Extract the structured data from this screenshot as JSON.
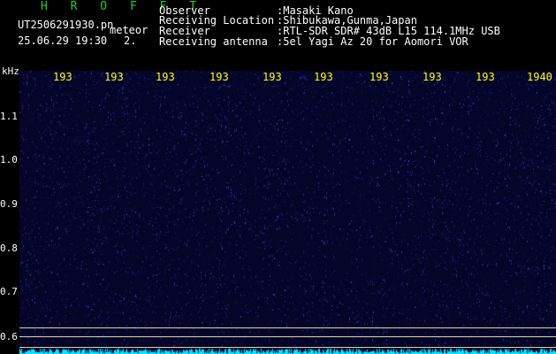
{
  "header": {
    "title": "H R O F F T",
    "filename": "UT2506291930.pn",
    "meteor_label": "meteor",
    "datetime": "25.06.29 19:30",
    "count": "2."
  },
  "station": {
    "rows": [
      {
        "key": "Observer",
        "value": ":Masaki Kano"
      },
      {
        "key": "Receiving Location",
        "value": ":Shibukawa,Gunma,Japan"
      },
      {
        "key": "Receiver",
        "value": ":RTL-SDR SDR# 43dB L15 114.1MHz USB"
      },
      {
        "key": "Receiving antenna",
        "value": ":5el Yagi Az 20 for Aomori VOR"
      }
    ]
  },
  "yaxis": {
    "unit": "kHz",
    "ticks": [
      "1.1",
      "1.0",
      "0.9",
      "0.8",
      "0.7",
      "0.6"
    ]
  },
  "xaxis": {
    "labels": [
      "193",
      "193",
      "193",
      "193",
      "193",
      "193",
      "193",
      "193",
      "193",
      "1940"
    ]
  },
  "colors": {
    "background": "#05052a",
    "noise": "#3a3acc",
    "signal": "#00e5ff",
    "grid": "#d8d8a0",
    "time_labels": "#ffff00",
    "title": "#22cc22"
  }
}
